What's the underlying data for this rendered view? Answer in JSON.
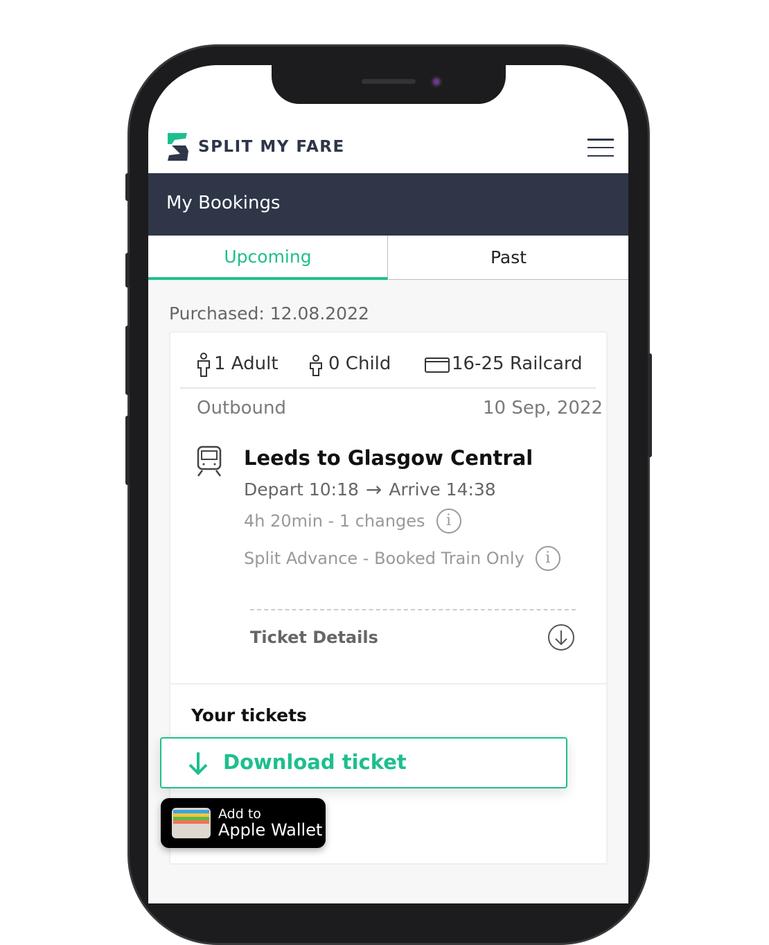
{
  "brand": {
    "name": "SPLIT MY FARE",
    "colors": {
      "accent": "#1dbf8e",
      "navy": "#2e3648"
    }
  },
  "header": {
    "title": "My Bookings",
    "menu_icon": "hamburger-icon"
  },
  "tabs": [
    {
      "label": "Upcoming",
      "active": true
    },
    {
      "label": "Past",
      "active": false
    }
  ],
  "booking": {
    "purchased": "Purchased: 12.08.2022",
    "passengers": {
      "adult": "1 Adult",
      "child": "0 Child",
      "railcard": "16-25 Railcard"
    },
    "direction": "Outbound",
    "date": "10 Sep, 2022",
    "route": "Leeds to Glasgow Central",
    "depart": "Depart 10:18",
    "arrive": "Arrive 14:38",
    "duration": "4h 20min - 1 changes",
    "fare": "Split Advance - Booked Train Only",
    "info_glyph": "i",
    "ticket_details": "Ticket Details"
  },
  "tickets": {
    "heading": "Your tickets",
    "download": "Download ticket",
    "wallet_line1": "Add to",
    "wallet_line2": "Apple Wallet"
  }
}
